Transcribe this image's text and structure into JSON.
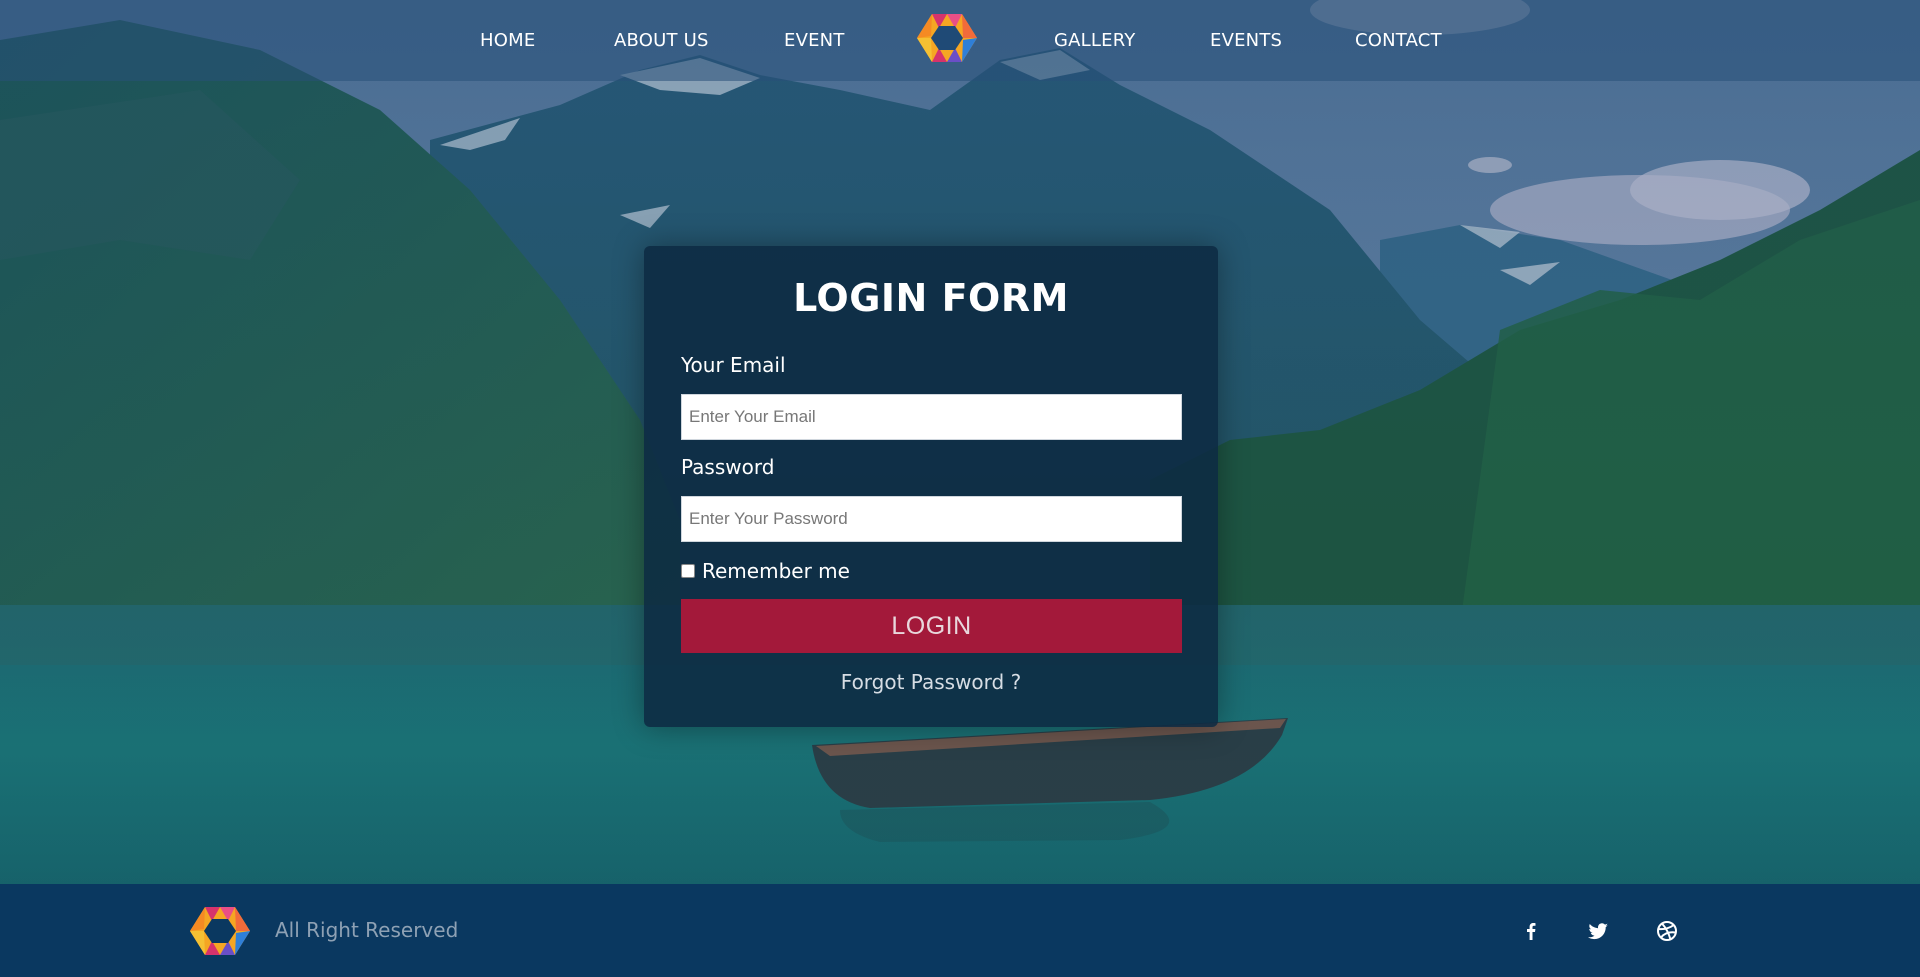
{
  "nav": {
    "items": [
      {
        "label": "HOME"
      },
      {
        "label": "ABOUT US"
      },
      {
        "label": "EVENT"
      },
      {
        "label": "GALLERY"
      },
      {
        "label": "EVENTS"
      },
      {
        "label": "CONTACT"
      }
    ],
    "logo_icon": "hexagon-logo-icon"
  },
  "login": {
    "title": "LOGIN FORM",
    "email_label": "Your Email",
    "email_placeholder": "Enter Your Email",
    "email_value": "",
    "password_label": "Password",
    "password_placeholder": "Enter Your Password",
    "password_value": "",
    "remember_label": "Remember me",
    "remember_checked": false,
    "submit_label": "LOGIN",
    "forgot_label": "Forgot Password ?"
  },
  "footer": {
    "rights": "All Right Reserved",
    "social": [
      {
        "icon": "facebook-icon"
      },
      {
        "icon": "twitter-icon"
      },
      {
        "icon": "dribbble-icon"
      }
    ]
  },
  "colors": {
    "nav_overlay": "#2f5a80",
    "card_bg": "#0d2a42",
    "login_button": "#a3193a",
    "footer_bg": "#0a3860",
    "logo_orange": "#f5a623",
    "logo_magenta": "#d6336c",
    "logo_blue": "#2f7fd8"
  }
}
